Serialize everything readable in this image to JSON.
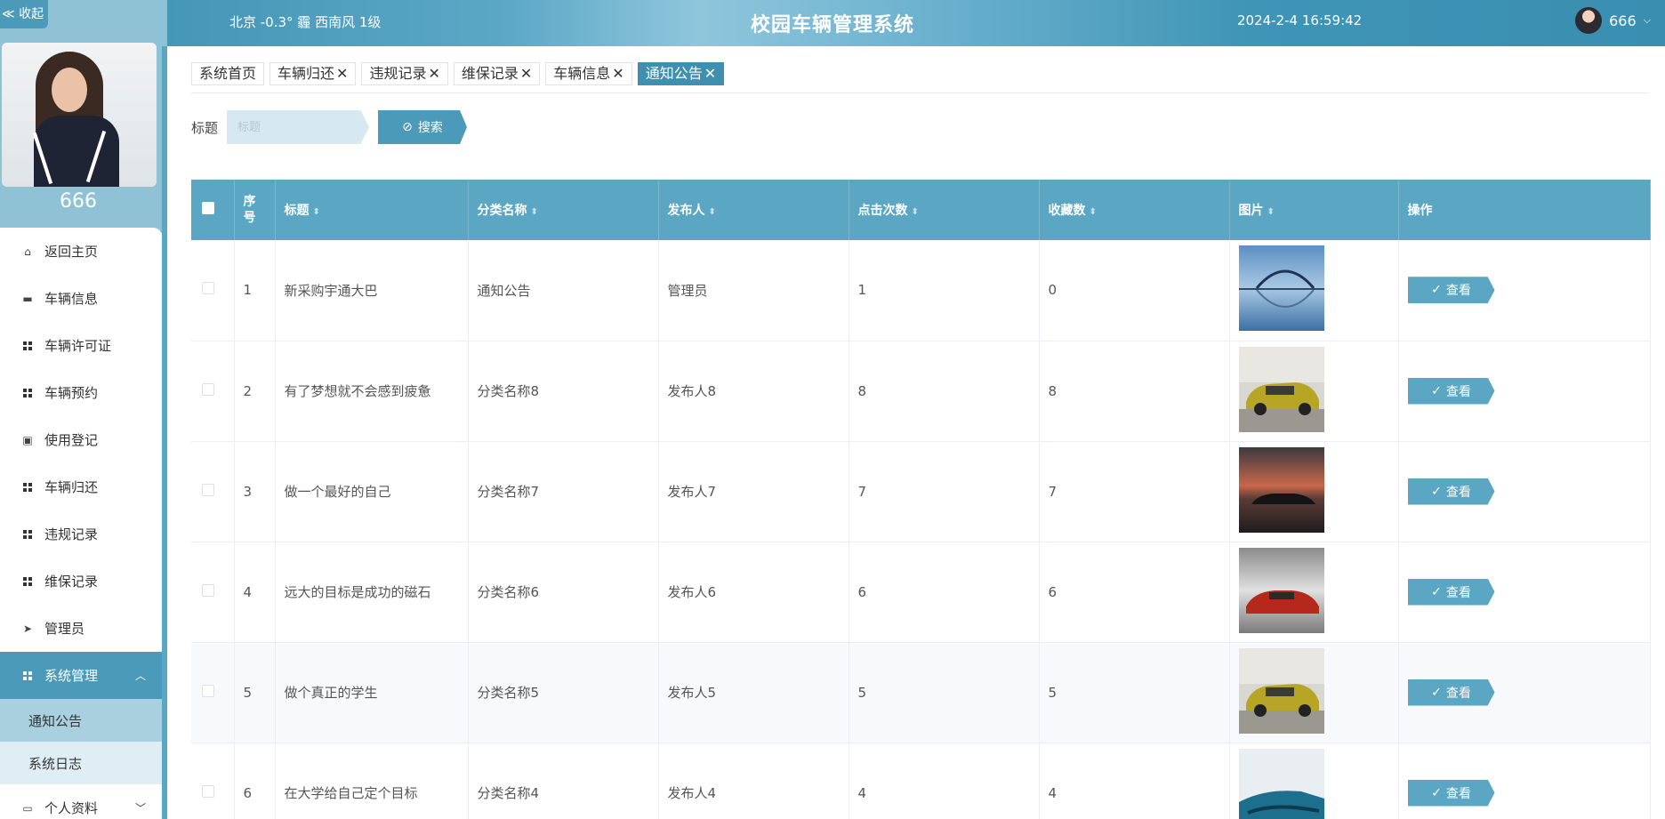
{
  "header": {
    "weather": "北京  -0.3°  霾  西南风  1级",
    "title": "校园车辆管理系统",
    "datetime": "2024-2-4 16:59:42",
    "username": "666",
    "dropdown_icon": "chevron-down-icon"
  },
  "sidebar": {
    "collapse_label": "≪ 收起",
    "username": "666",
    "menu": [
      {
        "label": "返回主页",
        "icon": "home-icon"
      },
      {
        "label": "车辆信息",
        "icon": "chat-icon"
      },
      {
        "label": "车辆许可证",
        "icon": "grid-icon"
      },
      {
        "label": "车辆预约",
        "icon": "grid-icon"
      },
      {
        "label": "使用登记",
        "icon": "clipboard-icon"
      },
      {
        "label": "车辆归还",
        "icon": "grid-icon"
      },
      {
        "label": "违规记录",
        "icon": "grid-icon"
      },
      {
        "label": "维保记录",
        "icon": "grid-icon"
      },
      {
        "label": "管理员",
        "icon": "send-icon"
      },
      {
        "label": "系统管理",
        "icon": "grid-icon"
      }
    ],
    "submenu": [
      "通知公告",
      "系统日志"
    ],
    "profile_menu": "个人资料"
  },
  "tags": [
    "系统首页",
    "车辆归还",
    "违规记录",
    "维保记录",
    "车辆信息",
    "通知公告"
  ],
  "search": {
    "label": "标题",
    "placeholder": "标题",
    "button": "搜索"
  },
  "table": {
    "headers": [
      "序号",
      "标题",
      "分类名称",
      "发布人",
      "点击次数",
      "收藏数",
      "图片",
      "操作"
    ],
    "rows": [
      {
        "no": "1",
        "title": "新采购宇通大巴",
        "category": "通知公告",
        "publisher": "管理员",
        "clicks": "1",
        "favorites": "0",
        "image": "bridge-lake",
        "action": "查看"
      },
      {
        "no": "2",
        "title": "有了梦想就不会感到疲惫",
        "category": "分类名称8",
        "publisher": "发布人8",
        "clicks": "8",
        "favorites": "8",
        "image": "yellow-car",
        "action": "查看"
      },
      {
        "no": "3",
        "title": "做一个最好的自己",
        "category": "分类名称7",
        "publisher": "发布人7",
        "clicks": "7",
        "favorites": "7",
        "image": "sunset-car",
        "action": "查看"
      },
      {
        "no": "4",
        "title": "远大的目标是成功的磁石",
        "category": "分类名称6",
        "publisher": "发布人6",
        "clicks": "6",
        "favorites": "6",
        "image": "red-car",
        "action": "查看"
      },
      {
        "no": "5",
        "title": "做个真正的学生",
        "category": "分类名称5",
        "publisher": "发布人5",
        "clicks": "5",
        "favorites": "5",
        "image": "yellow-car",
        "action": "查看"
      },
      {
        "no": "6",
        "title": "在大学给自己定个目标",
        "category": "分类名称4",
        "publisher": "发布人4",
        "clicks": "4",
        "favorites": "4",
        "image": "blue-car",
        "action": "查看"
      }
    ]
  },
  "colors": {
    "accent": "#4b9ab9",
    "header_bg": "#3a8fb1"
  }
}
